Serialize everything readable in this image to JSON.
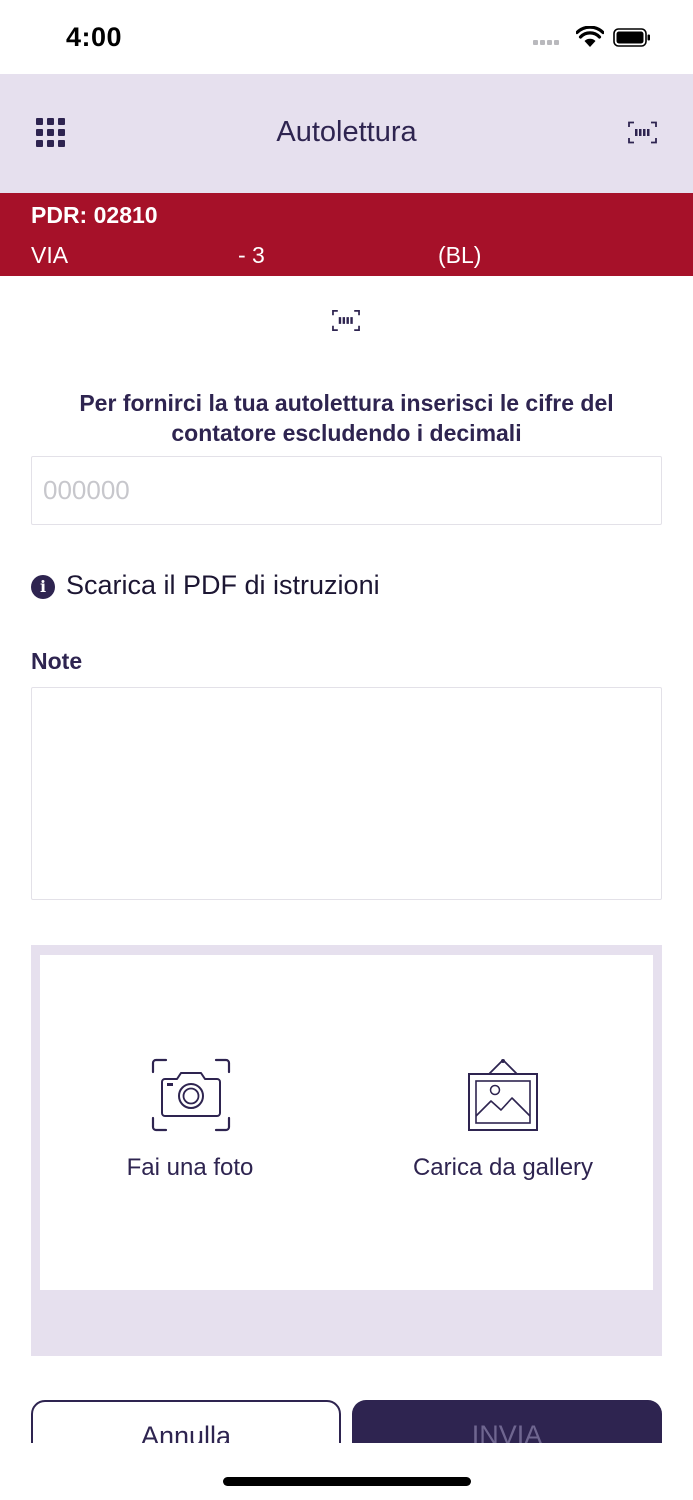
{
  "status_bar": {
    "time": "4:00"
  },
  "nav": {
    "title": "Autolettura",
    "menu_icon": "grid-icon",
    "scan_icon": "barcode-scan-icon"
  },
  "banner": {
    "pdr": "PDR: 02810",
    "address_street": "VIA",
    "address_number": "- 3",
    "address_province": "(BL)"
  },
  "form": {
    "instructions": "Per fornirci la tua autolettura inserisci le cifre del contatore escludendo i decimali",
    "reading_placeholder": "000000",
    "reading_value": "",
    "pdf_link": "Scarica il PDF di istruzioni",
    "note_label": "Note",
    "note_value": ""
  },
  "photo": {
    "camera_label": "Fai una foto",
    "gallery_label": "Carica da gallery"
  },
  "actions": {
    "cancel_label": "Annulla",
    "send_label": "INVIA"
  },
  "colors": {
    "brand": "#2e2450",
    "banner": "#a61129",
    "nav_bg": "#e6e0ee",
    "send_text_disabled": "#6f6690"
  }
}
